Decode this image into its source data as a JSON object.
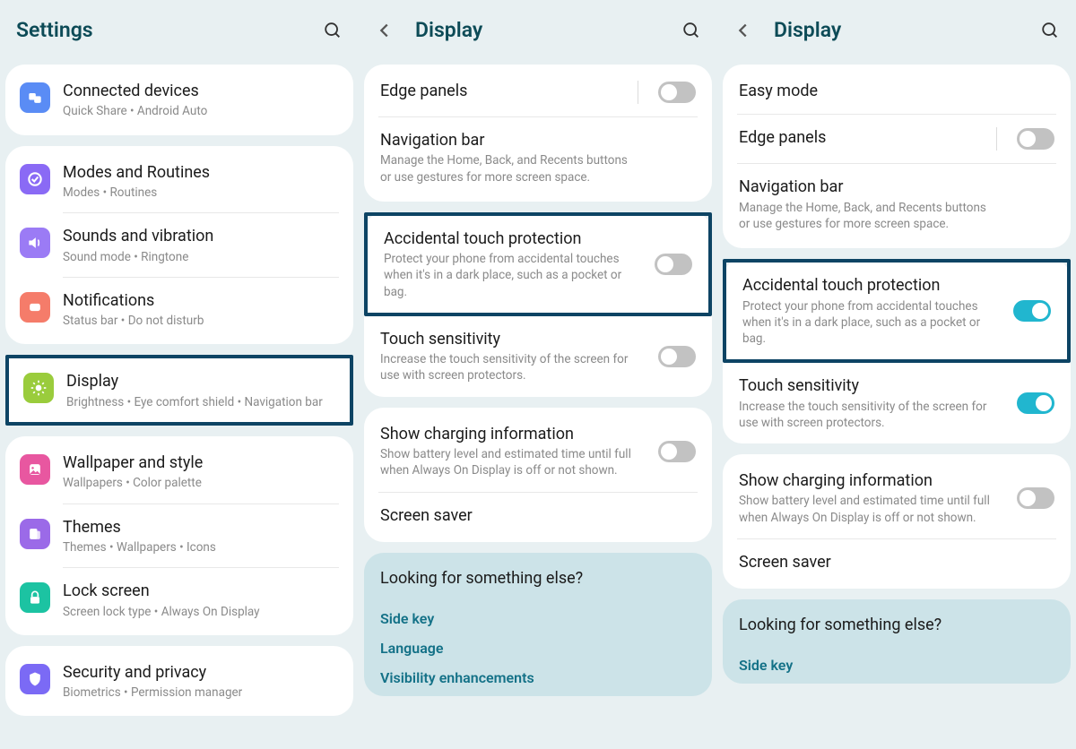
{
  "screen1": {
    "title": "Settings",
    "items": [
      {
        "title": "Connected devices",
        "sub": "Quick Share  •  Android Auto"
      },
      {
        "title": "Modes and Routines",
        "sub": "Modes  •  Routines"
      },
      {
        "title": "Sounds and vibration",
        "sub": "Sound mode  •  Ringtone"
      },
      {
        "title": "Notifications",
        "sub": "Status bar  •  Do not disturb"
      },
      {
        "title": "Display",
        "sub": "Brightness  •  Eye comfort shield  •  Navigation bar"
      },
      {
        "title": "Wallpaper and style",
        "sub": "Wallpapers  •  Color palette"
      },
      {
        "title": "Themes",
        "sub": "Themes  •  Wallpapers  •  Icons"
      },
      {
        "title": "Lock screen",
        "sub": "Screen lock type  •  Always On Display"
      },
      {
        "title": "Security and privacy",
        "sub": "Biometrics  •  Permission manager"
      }
    ]
  },
  "screen2": {
    "title": "Display",
    "edge": "Edge panels",
    "nav_title": "Navigation bar",
    "nav_sub": "Manage the Home, Back, and Recents buttons or use gestures for more screen space.",
    "atp_title": "Accidental touch protection",
    "atp_sub": "Protect your phone from accidental touches when it's in a dark place, such as a pocket or bag.",
    "ts_title": "Touch sensitivity",
    "ts_sub": "Increase the touch sensitivity of the screen for use with screen protectors.",
    "sci_title": "Show charging information",
    "sci_sub": "Show battery level and estimated time until full when Always On Display is off or not shown.",
    "ss_title": "Screen saver",
    "looking": "Looking for something else?",
    "links": [
      "Side key",
      "Language",
      "Visibility enhancements"
    ]
  },
  "screen3": {
    "title": "Display",
    "easy": "Easy mode",
    "edge": "Edge panels",
    "nav_title": "Navigation bar",
    "nav_sub": "Manage the Home, Back, and Recents buttons or use gestures for more screen space.",
    "atp_title": "Accidental touch protection",
    "atp_sub": "Protect your phone from accidental touches when it's in a dark place, such as a pocket or bag.",
    "ts_title": "Touch sensitivity",
    "ts_sub": "Increase the touch sensitivity of the screen for use with screen protectors.",
    "sci_title": "Show charging information",
    "sci_sub": "Show battery level and estimated time until full when Always On Display is off or not shown.",
    "ss_title": "Screen saver",
    "looking": "Looking for something else?",
    "links": [
      "Side key"
    ]
  }
}
